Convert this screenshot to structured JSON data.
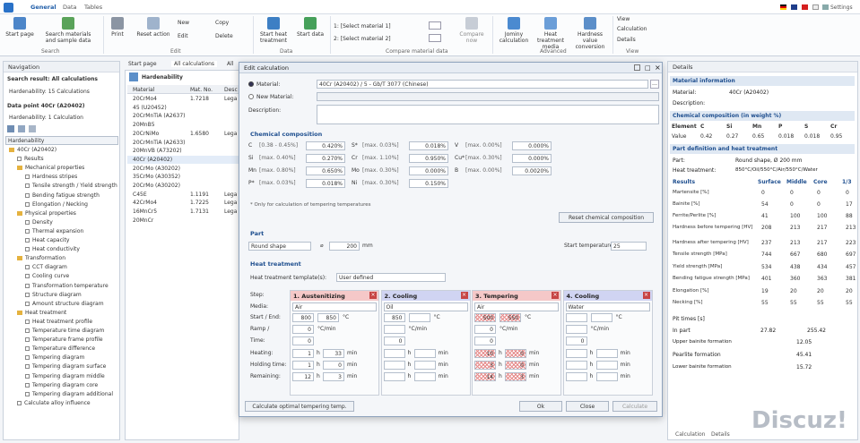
{
  "ribbon": {
    "tabs": [
      "General",
      "Data",
      "Tables"
    ],
    "settings_label": "Settings",
    "groups": {
      "search": {
        "label": "Search",
        "buttons": [
          "Start page",
          "Search materials and sample data"
        ]
      },
      "edit": {
        "label": "Edit",
        "buttons": [
          "Print",
          "Reset action",
          "New",
          "Edit",
          "Copy",
          "Delete"
        ]
      },
      "data": {
        "label": "Data",
        "buttons": [
          "Start heat treatment",
          "Start data"
        ]
      },
      "compare": {
        "label": "Compare material data",
        "rows": [
          "1: [Select material 1]",
          "2: [Select material 2]"
        ],
        "compare_now": "Compare now"
      },
      "advanced": {
        "label": "Advanced",
        "buttons": [
          "Jominy calculation",
          "Heat treatment media",
          "Hardness value conversion"
        ]
      },
      "view": {
        "label": "View",
        "buttons": [
          "View",
          "Calculation",
          "Details"
        ]
      }
    }
  },
  "navigation": {
    "title": "Navigation",
    "search_result": "Search result: All calculations",
    "search_count": "Hardenability: 15 Calculations",
    "data_point": "Data point 40Cr (A20402)",
    "data_count": "Hardenability: 1 Calculation",
    "dropdown": "Hardenability",
    "tree": [
      {
        "label": "40Cr (A20402)",
        "level": 0,
        "kind": "folder"
      },
      {
        "label": "Results",
        "level": 1,
        "kind": "leaf"
      },
      {
        "label": "Mechanical properties",
        "level": 1,
        "kind": "folder"
      },
      {
        "label": "Hardness stripes",
        "level": 2,
        "kind": "leaf"
      },
      {
        "label": "Tensile strength / Yield strength",
        "level": 2,
        "kind": "leaf"
      },
      {
        "label": "Bending fatigue strength",
        "level": 2,
        "kind": "leaf"
      },
      {
        "label": "Elongation / Necking",
        "level": 2,
        "kind": "leaf"
      },
      {
        "label": "Physical properties",
        "level": 1,
        "kind": "folder"
      },
      {
        "label": "Density",
        "level": 2,
        "kind": "leaf"
      },
      {
        "label": "Thermal expansion",
        "level": 2,
        "kind": "leaf"
      },
      {
        "label": "Heat capacity",
        "level": 2,
        "kind": "leaf"
      },
      {
        "label": "Heat conductivity",
        "level": 2,
        "kind": "leaf"
      },
      {
        "label": "Transformation",
        "level": 1,
        "kind": "folder"
      },
      {
        "label": "CCT diagram",
        "level": 2,
        "kind": "leaf"
      },
      {
        "label": "Cooling curve",
        "level": 2,
        "kind": "leaf"
      },
      {
        "label": "Transformation temperature",
        "level": 2,
        "kind": "leaf"
      },
      {
        "label": "Structure diagram",
        "level": 2,
        "kind": "leaf"
      },
      {
        "label": "Amount structure diagram",
        "level": 2,
        "kind": "leaf"
      },
      {
        "label": "Heat treatment",
        "level": 1,
        "kind": "folder"
      },
      {
        "label": "Heat treatment profile",
        "level": 2,
        "kind": "leaf"
      },
      {
        "label": "Temperature time diagram",
        "level": 2,
        "kind": "leaf"
      },
      {
        "label": "Temperature frame profile",
        "level": 2,
        "kind": "leaf"
      },
      {
        "label": "Temperature difference",
        "level": 2,
        "kind": "leaf"
      },
      {
        "label": "Tempering diagram",
        "level": 2,
        "kind": "leaf"
      },
      {
        "label": "Tempering diagram surface",
        "level": 2,
        "kind": "leaf"
      },
      {
        "label": "Tempering diagram middle",
        "level": 2,
        "kind": "leaf"
      },
      {
        "label": "Tempering diagram core",
        "level": 2,
        "kind": "leaf"
      },
      {
        "label": "Tempering diagram additional",
        "level": 2,
        "kind": "leaf"
      },
      {
        "label": "Calculate alloy influence",
        "level": 1,
        "kind": "leaf"
      }
    ]
  },
  "doc_tabs": [
    "Start page",
    "All calculations",
    "All"
  ],
  "list": {
    "title": "Hardenability",
    "columns": [
      "Material",
      "Mat. No.",
      "Desc"
    ],
    "rows": [
      [
        "20CrMo4",
        "1.7218",
        "Lega"
      ],
      [
        "45 (U20452)",
        "",
        ""
      ],
      [
        "20CrMnTiA (A2637)",
        "",
        ""
      ],
      [
        "20MnB5",
        "",
        ""
      ],
      [
        "20CrNiMo",
        "1.6580",
        "Lega"
      ],
      [
        "20CrMnTiA (A2633)",
        "",
        ""
      ],
      [
        "20MnVB (A73202)",
        "",
        ""
      ],
      [
        "40Cr (A20402)",
        "",
        ""
      ],
      [
        "20CrMo (A30202)",
        "",
        ""
      ],
      [
        "35CrMo (A30352)",
        "",
        ""
      ],
      [
        "20CrMo (A30202)",
        "",
        ""
      ],
      [
        "C45E",
        "1.1191",
        "Lega"
      ],
      [
        "42CrMo4",
        "1.7225",
        "Lega"
      ],
      [
        "16MnCr5",
        "1.7131",
        "Lega"
      ],
      [
        "20MnCr",
        "",
        ""
      ]
    ]
  },
  "dialog": {
    "title": "Edit calculation",
    "material_radio": "Material:",
    "material_value": "40Cr (A20402) / 5 - Gb/T 3077 (Chinese)",
    "new_material_radio": "New Material:",
    "description_label": "Description:",
    "chem_title": "Chemical composition",
    "chem": [
      {
        "el": "C",
        "range": "[0.38 - 0.45%]",
        "val": "0.420%"
      },
      {
        "el": "Si",
        "range": "[max. 0.40%]",
        "val": "0.270%"
      },
      {
        "el": "Mn",
        "range": "[max. 0.80%]",
        "val": "0.650%"
      },
      {
        "el": "P*",
        "range": "[max. 0.03%]",
        "val": "0.018%"
      },
      {
        "el": "S*",
        "range": "[max. 0.03%]",
        "val": "0.018%"
      },
      {
        "el": "Cr",
        "range": "[max. 1.10%]",
        "val": "0.950%"
      },
      {
        "el": "Mo",
        "range": "[max. 0.30%]",
        "val": "0.000%"
      },
      {
        "el": "Ni",
        "range": "[max. 0.30%]",
        "val": "0.150%"
      },
      {
        "el": "V",
        "range": "[max. 0.00%]",
        "val": "0.000%"
      },
      {
        "el": "Cu*",
        "range": "[max. 0.30%]",
        "val": "0.000%"
      },
      {
        "el": "B",
        "range": "[max. 0.00%]",
        "val": "0.0020%"
      }
    ],
    "chem_note": "* Only for calculation of tempering temperatures",
    "reset_chem_btn": "Reset chemical composition",
    "part_title": "Part",
    "part_shape": "Round shape",
    "part_diameter": "200",
    "part_unit": "mm",
    "start_temp_label": "Start temperature:",
    "start_temp_value": "25",
    "ht_title": "Heat treatment",
    "ht_template_label": "Heat treatment template(s):",
    "ht_template_value": "User defined",
    "row_labels": [
      "Step:",
      "Media:",
      "Start / End:",
      "Ramp /",
      "Time:",
      "Heating:",
      "Holding time:",
      "Remaining:"
    ],
    "steps": [
      {
        "name": "1. Austenitizing",
        "color": "#f5c8c8",
        "media": "Air",
        "start": "800",
        "end": "850",
        "temp_unit": "°C",
        "ramp": "0",
        "ramp_unit": "°C/min",
        "time": "0",
        "heating_h": "1",
        "heating_m": "33",
        "hold_h": "1",
        "hold_m": "0",
        "rem_h": "12",
        "rem_m": "3"
      },
      {
        "name": "2. Cooling",
        "color": "#d0d4f2",
        "media": "Oil",
        "start": "850",
        "end": "",
        "temp_unit": "°C",
        "ramp": "",
        "ramp_unit": "°C/min",
        "time": "0",
        "heating_h": "",
        "heating_m": "",
        "hold_h": "",
        "hold_m": "",
        "rem_h": "",
        "rem_m": ""
      },
      {
        "name": "3. Tempering",
        "color": "#f5c8c8",
        "media": "Air",
        "start": "500",
        "end": "550",
        "temp_unit": "°C",
        "ramp": "0",
        "ramp_unit": "°C/min",
        "time": "0",
        "heating_h": "10",
        "heating_m": "0",
        "hold_h": "3",
        "hold_m": "0",
        "rem_h": "14",
        "rem_m": "3"
      },
      {
        "name": "4. Cooling",
        "color": "#d0d4f2",
        "media": "Water",
        "start": "",
        "end": "",
        "temp_unit": "°C",
        "ramp": "",
        "ramp_unit": "°C/min",
        "time": "0",
        "heating_h": "",
        "heating_m": "",
        "hold_h": "",
        "hold_m": "",
        "rem_h": "",
        "rem_m": ""
      }
    ],
    "unit_h": "h",
    "unit_min": "min",
    "calc_temp_btn": "Calculate optimal tempering temp.",
    "ok_btn": "Ok",
    "close_btn": "Close",
    "calculate_btn": "Calculate"
  },
  "details": {
    "title": "Details",
    "material_info": "Material information",
    "material_label": "Material:",
    "material_value": "40Cr (A20402)",
    "description_label": "Description:",
    "chem_title": "Chemical composition (in weight %)",
    "chem_header": [
      "Element",
      "C",
      "Si",
      "Mn",
      "P",
      "S",
      "Cr"
    ],
    "chem_values": [
      "Value",
      "0.42",
      "0.27",
      "0.65",
      "0.018",
      "0.018",
      "0.95"
    ],
    "part_title": "Part definition and heat treatment",
    "part_label": "Part:",
    "part_value": "Round shape, Ø 200 mm",
    "ht_label": "Heat treatment:",
    "ht_value": "850°C/Oil/550°C/Air/550°C/Water",
    "results_header": [
      "Results",
      "Surface",
      "Middle",
      "Core",
      "1/3"
    ],
    "results": [
      [
        "Martensite [%]",
        "0",
        "0",
        "0",
        "0"
      ],
      [
        "Bainite [%]",
        "54",
        "0",
        "0",
        "17"
      ],
      [
        "Ferrite/Perlite [%]",
        "41",
        "100",
        "100",
        "88"
      ],
      [
        "Hardness before tempering [HV]",
        "208",
        "213",
        "217",
        "213"
      ],
      [
        "Hardness after tempering [HV]",
        "237",
        "213",
        "217",
        "223"
      ],
      [
        "Tensile strength [MPa]",
        "744",
        "667",
        "680",
        "697"
      ],
      [
        "Yield strength [MPa]",
        "534",
        "438",
        "434",
        "457"
      ],
      [
        "Bending fatigue strength [MPa]",
        "401",
        "360",
        "363",
        "381"
      ],
      [
        "Elongation [%]",
        "19",
        "20",
        "20",
        "20"
      ],
      [
        "Necking [%]",
        "55",
        "55",
        "55",
        "55"
      ]
    ],
    "extra_label": "Pit times [s]",
    "in_part_label": "In part",
    "in_part_values": [
      "27.82",
      "255.42"
    ],
    "upper_bainite": "Upper bainite formation",
    "upper_bainite_value": "12.05",
    "pearlite": "Pearlite formation",
    "pearlite_value": "45.41",
    "lower_bainite": "Lower bainite formation",
    "lower_bainite_value": "15.72",
    "bottom_tabs": [
      "Calculation",
      "Details"
    ]
  },
  "watermark": "Discuz!"
}
